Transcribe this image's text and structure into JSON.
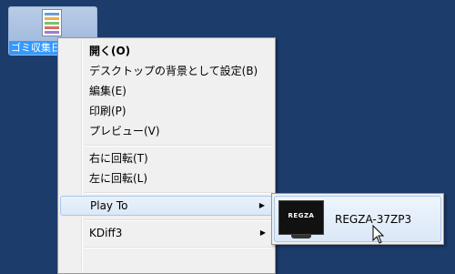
{
  "desktop": {
    "file_label": "ゴミ収集日"
  },
  "context_menu": {
    "items": [
      {
        "label": "開く(O)"
      },
      {
        "label": "デスクトップの背景として設定(B)"
      },
      {
        "label": "編集(E)"
      },
      {
        "label": "印刷(P)"
      },
      {
        "label": "プレビュー(V)"
      },
      {
        "label": "右に回転(T)"
      },
      {
        "label": "左に回転(L)"
      },
      {
        "label": "Play To"
      },
      {
        "label": "KDiff3"
      }
    ]
  },
  "submenu": {
    "device_brand": "REGZA",
    "device_name": "REGZA-37ZP3"
  },
  "icons": {
    "submenu_arrow": "▶",
    "tv": "tv-icon",
    "cursor": "pointer-cursor-icon"
  },
  "colors": {
    "desktop_bg": "#1c3c6c",
    "menu_bg": "#f0f0f0",
    "highlight_border": "#a8c8ea"
  }
}
